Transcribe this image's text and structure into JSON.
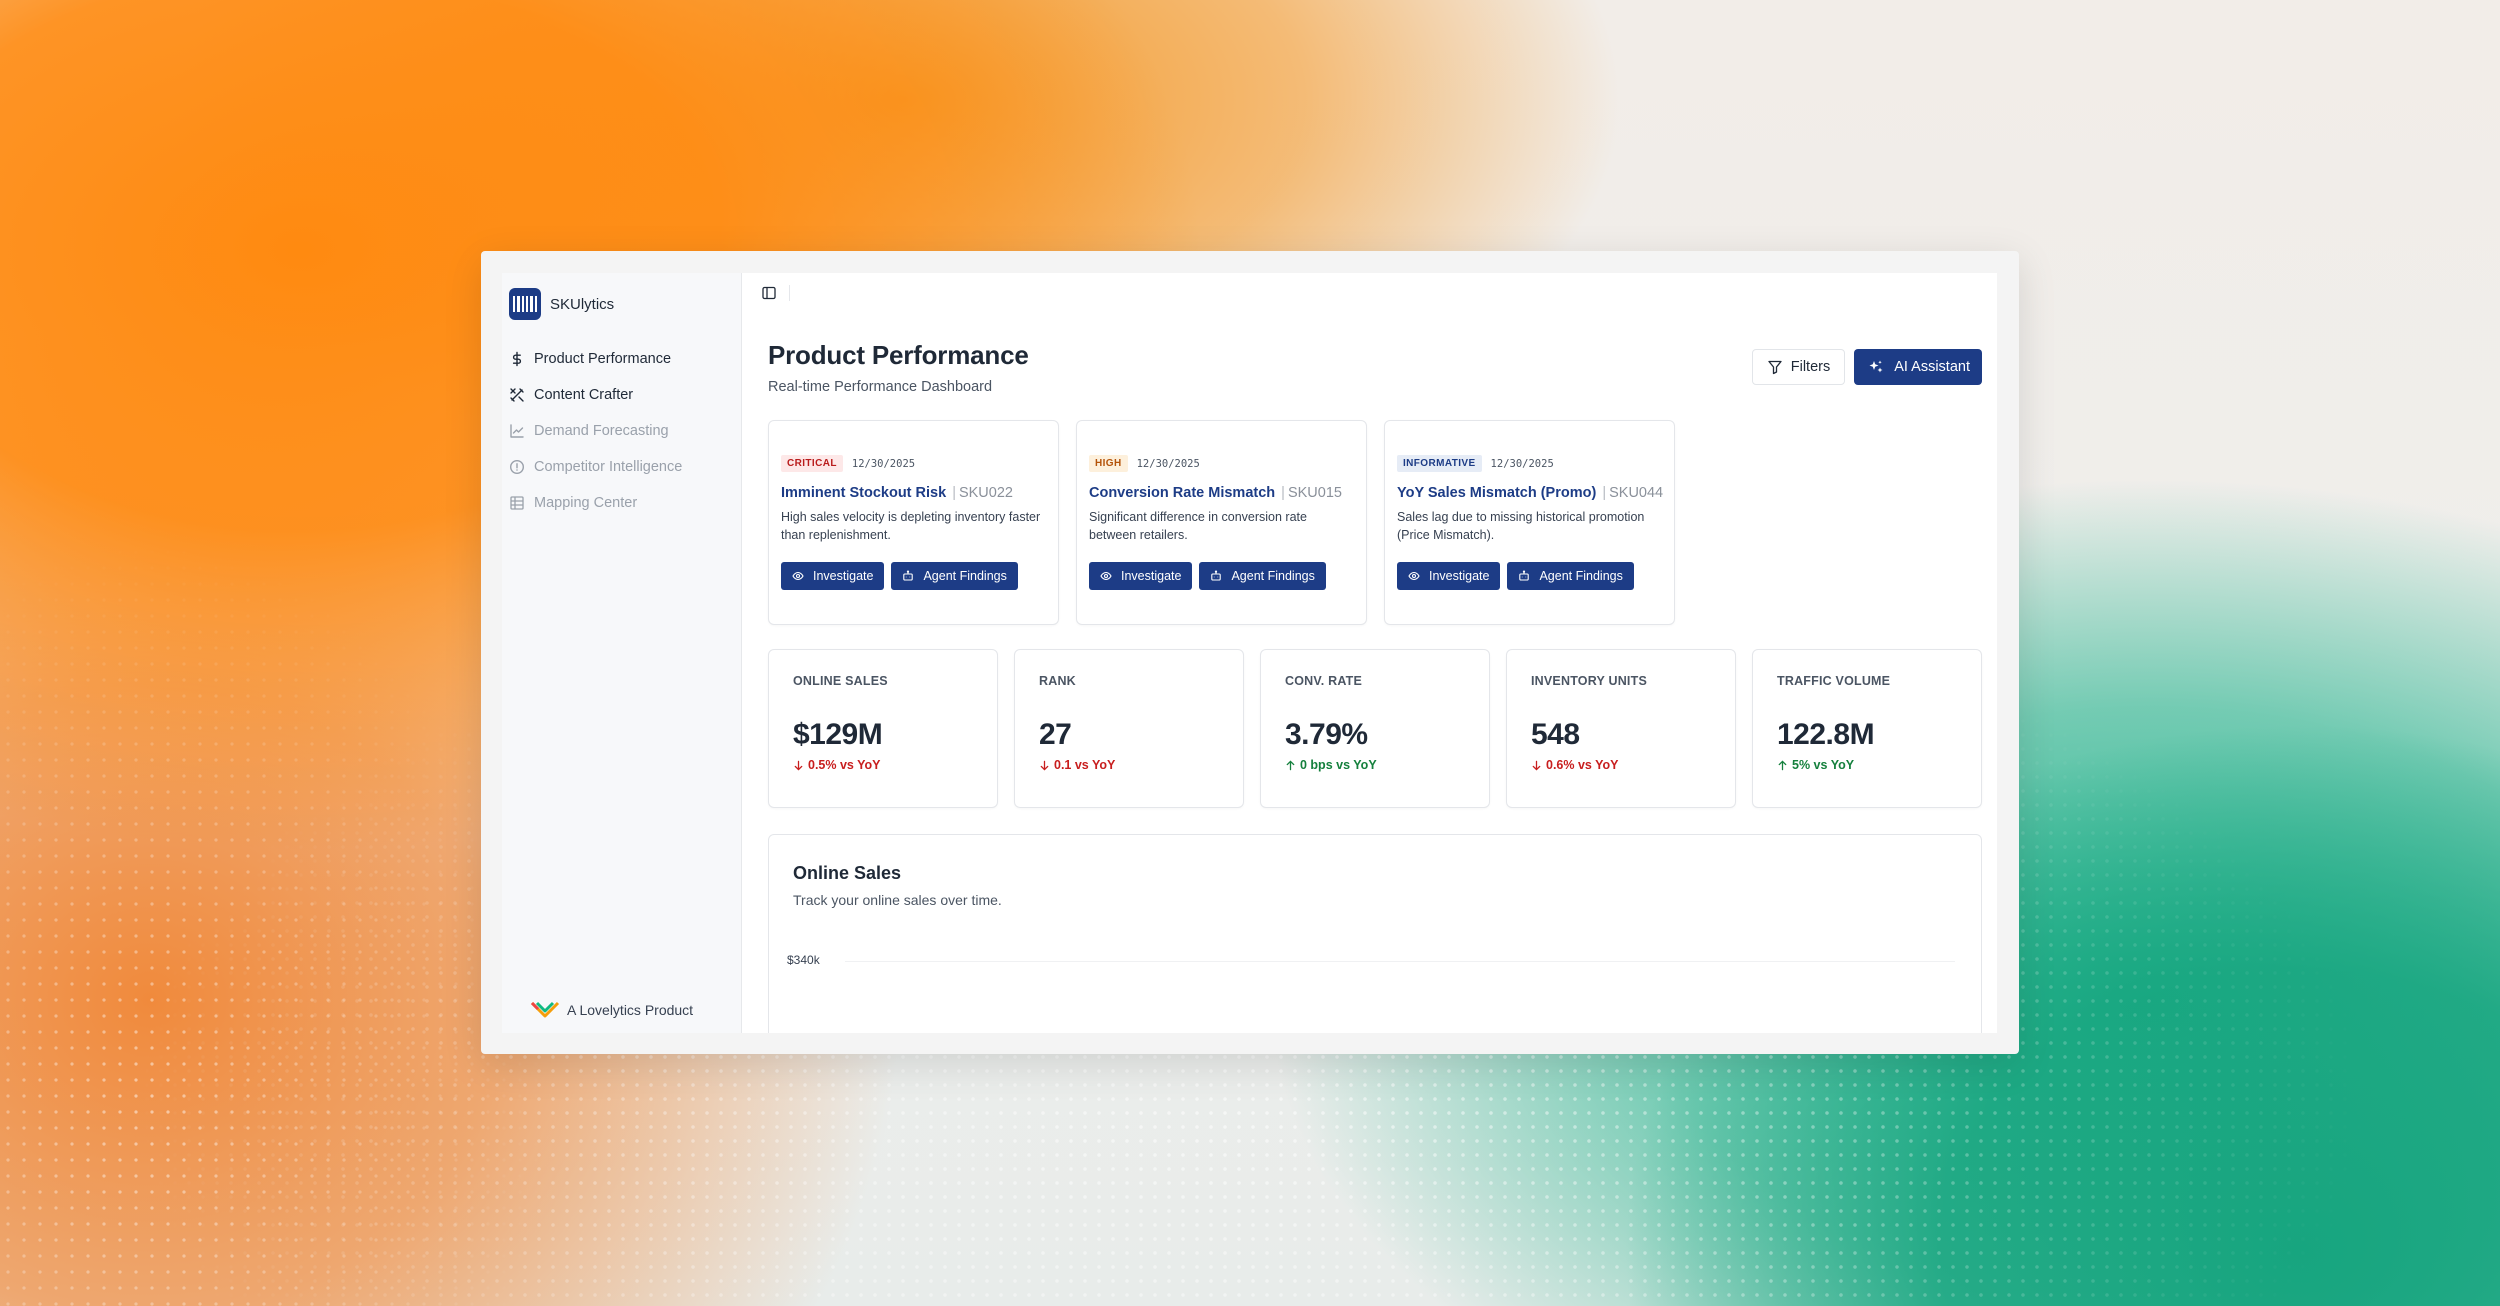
{
  "app": {
    "name": "SKUlytics",
    "footer": "A Lovelytics Product"
  },
  "colors": {
    "brand": "#1d3c86",
    "critical": "#b91c1c",
    "high": "#b45309",
    "positive": "#15803d",
    "negative": "#c81e1e"
  },
  "sidebar": {
    "items": [
      {
        "label": "Product Performance",
        "icon": "dollar-icon",
        "enabled": true
      },
      {
        "label": "Content Crafter",
        "icon": "content-tools-icon",
        "enabled": true
      },
      {
        "label": "Demand Forecasting",
        "icon": "chart-icon",
        "enabled": false
      },
      {
        "label": "Competitor Intelligence",
        "icon": "info-circle-icon",
        "enabled": false
      },
      {
        "label": "Mapping Center",
        "icon": "grid-icon",
        "enabled": false
      }
    ]
  },
  "header": {
    "title": "Product Performance",
    "subtitle": "Real-time Performance Dashboard",
    "filters_label": "Filters",
    "assistant_label": "AI Assistant"
  },
  "alerts": [
    {
      "severity": "CRITICAL",
      "date": "12/30/2025",
      "title": "Imminent Stockout Risk",
      "sku": "SKU022",
      "description": "High sales velocity is depleting inventory faster than replenishment.",
      "investigate_label": "Investigate",
      "findings_label": "Agent Findings"
    },
    {
      "severity": "HIGH",
      "date": "12/30/2025",
      "title": "Conversion Rate Mismatch",
      "sku": "SKU015",
      "description": "Significant difference in conversion rate between retailers.",
      "investigate_label": "Investigate",
      "findings_label": "Agent Findings"
    },
    {
      "severity": "INFORMATIVE",
      "date": "12/30/2025",
      "title": "YoY Sales Mismatch (Promo)",
      "sku": "SKU044",
      "description": "Sales lag due to missing historical promotion (Price Mismatch).",
      "investigate_label": "Investigate",
      "findings_label": "Agent Findings"
    }
  ],
  "kpis": [
    {
      "label": "ONLINE SALES",
      "value": "$129M",
      "change": "0.5% vs YoY",
      "direction": "down"
    },
    {
      "label": "RANK",
      "value": "27",
      "change": "0.1 vs YoY",
      "direction": "down"
    },
    {
      "label": "CONV. RATE",
      "value": "3.79%",
      "change": "0 bps vs YoY",
      "direction": "up"
    },
    {
      "label": "INVENTORY UNITS",
      "value": "548",
      "change": "0.6% vs YoY",
      "direction": "down"
    },
    {
      "label": "TRAFFIC VOLUME",
      "value": "122.8M",
      "change": "5% vs YoY",
      "direction": "up"
    }
  ],
  "chart": {
    "title": "Online Sales",
    "subtitle": "Track your online sales over time.",
    "y_tick_top": "$340k"
  }
}
